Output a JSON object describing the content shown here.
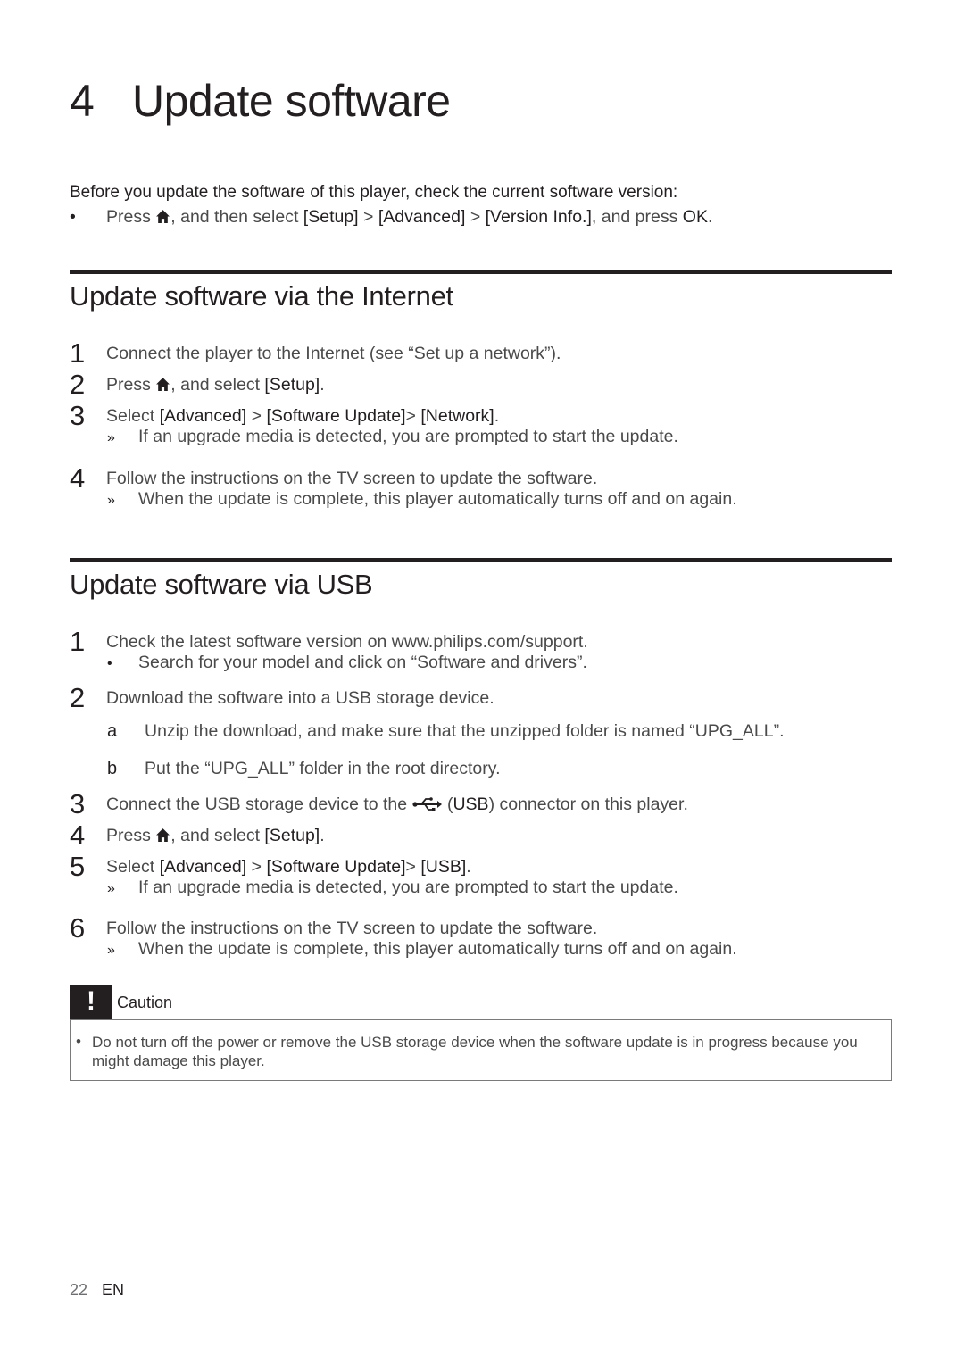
{
  "chapter": {
    "number": "4",
    "title": "Update software"
  },
  "intro": {
    "text": "Before you update the software of this player, check the current software version:",
    "bullet": {
      "pre": "Press ",
      "icon": "home-icon",
      "mid": ", and then select ",
      "b1": "[Setup]",
      "sep1": " > ",
      "b2": "[Advanced]",
      "sep2": " > ",
      "b3": "[Version Info.]",
      "post": ", and press ",
      "b4": "OK",
      "end": "."
    }
  },
  "internet": {
    "title": "Update software via the Internet",
    "steps": [
      {
        "n": "1",
        "text": "Connect the player to the Internet (see “Set up a network”)."
      },
      {
        "n": "2",
        "pre": "Press ",
        "mid": ", and select ",
        "b1": "[Setup]",
        "end": "."
      },
      {
        "n": "3",
        "pre": "Select ",
        "b1": "[Advanced]",
        "sep1": " > ",
        "b2": "[Software Update]",
        "sep2": "> ",
        "b3": "[Network]",
        "end": ".",
        "result": "If an upgrade media is detected, you are prompted to start the update."
      },
      {
        "n": "4",
        "text": "Follow the instructions on the TV screen to update the software.",
        "result": "When the update is complete, this player automatically turns off and on again."
      }
    ]
  },
  "usb": {
    "title": "Update software via USB",
    "steps": [
      {
        "n": "1",
        "text": "Check the latest software version on www.philips.com/support.",
        "bullet": "Search for your model and click on “Software and drivers”."
      },
      {
        "n": "2",
        "text": "Download the software into a USB storage device.",
        "subs": [
          {
            "m": "a",
            "text": "Unzip the download, and make sure that the unzipped folder is named “UPG_ALL”."
          },
          {
            "m": "b",
            "text": "Put the “UPG_ALL” folder in the root directory."
          }
        ]
      },
      {
        "n": "3",
        "pre": "Connect the USB storage device to the ",
        "icon": "usb-icon",
        "paren_open": " (",
        "b1": "USB",
        "post": ") connector on this player."
      },
      {
        "n": "4",
        "pre": "Press ",
        "mid": ", and select ",
        "b1": "[Setup]",
        "end": "."
      },
      {
        "n": "5",
        "pre": "Select ",
        "b1": "[Advanced]",
        "sep1": " > ",
        "b2": "[Software Update]",
        "sep2": "> ",
        "b3": "[USB]",
        "end": ".",
        "result": "If an upgrade media is detected, you are prompted to start the update."
      },
      {
        "n": "6",
        "text": "Follow the instructions on the TV screen to update the software.",
        "result": "When the update is complete, this player automatically turns off and on again."
      }
    ]
  },
  "caution": {
    "badge": "!",
    "label": "Caution",
    "text": "Do not turn off the power or remove the USB storage device when the software update is in progress because you might damage this player."
  },
  "footer": {
    "page": "22",
    "lang": "EN"
  },
  "glyphs": {
    "bullet": "•",
    "result": "»"
  }
}
